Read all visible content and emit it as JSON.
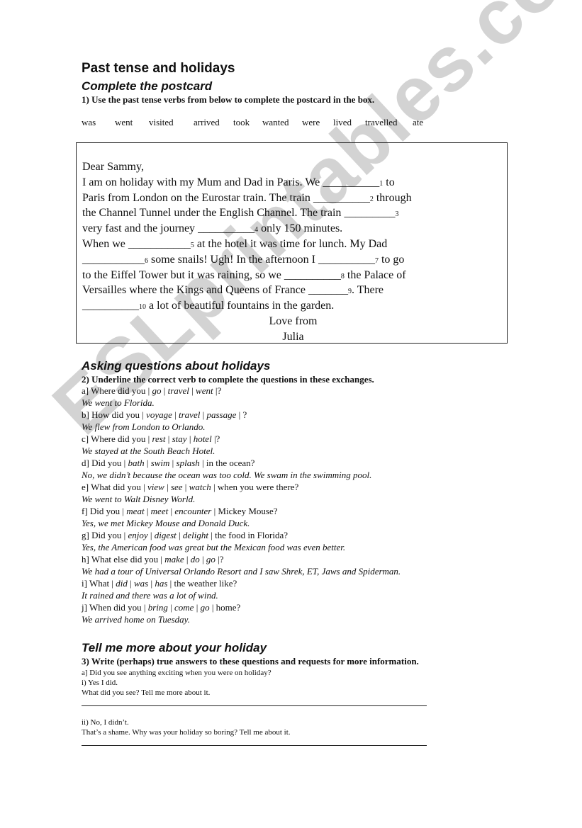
{
  "title": "Past tense and holidays",
  "section1": {
    "heading": "Complete the postcard",
    "instruction": "1) Use the past tense verbs from below to complete the postcard in the box.",
    "word_bank": [
      "was",
      "went",
      "visited",
      "arrived",
      "took",
      "wanted",
      "were",
      "lived",
      "travelled",
      "ate"
    ],
    "postcard": {
      "greeting": "Dear Sammy,",
      "lines": [
        {
          "pre": "I am on holiday with my Mum and Dad in Paris. We ",
          "blank": "__________",
          "num": "1",
          "post": " to"
        },
        {
          "pre": "Paris from London on the Eurostar train. The train ",
          "blank": "__________",
          "num": "2",
          "post": " through"
        },
        {
          "pre": "the Channel Tunnel under the English Channel. The train ",
          "blank": "_________",
          "num": "3",
          "post": ""
        },
        {
          "pre": "very fast and the journey ",
          "blank": "__________",
          "num": "4",
          "post": " only 150 minutes."
        },
        {
          "pre": "When we ",
          "blank": "___________",
          "num": "5",
          "post": " at the hotel it was time for lunch. My Dad"
        },
        {
          "pre": "",
          "blank": "___________",
          "num": "6",
          "post": " some snails! Ugh! In the afternoon I "
        },
        {
          "pre": "to the Eiffel Tower but it was raining, so we ",
          "blank": "__________",
          "num": "8",
          "post": " the Palace of"
        },
        {
          "pre": "Versailles where the Kings and Queens of France ",
          "blank": "_______",
          "num": "9",
          "post": ". There"
        },
        {
          "pre": "",
          "blank": "__________",
          "num": "10",
          "post": " a lot of beautiful fountains in the garden."
        }
      ],
      "line6_extra": {
        "blank": "__________",
        "num": "7",
        "post": " to go"
      },
      "closing": "Love from",
      "signature": "Julia"
    }
  },
  "section2": {
    "heading": "Asking questions about holidays",
    "instruction": "2) Underline the correct verb to complete the questions in these exchanges.",
    "items": [
      {
        "label": "a]",
        "pre": "Where did you |",
        "options": [
          "go",
          "travel",
          "went"
        ],
        "post": "|?",
        "answer": "We went to Florida."
      },
      {
        "label": "b]",
        "pre": "How did you |",
        "options": [
          "voyage",
          "travel",
          "passage"
        ],
        "post": "| ?",
        "answer": "We flew from London to Orlando."
      },
      {
        "label": "c]",
        "pre": "Where did you |",
        "options": [
          "rest",
          "stay",
          "hotel"
        ],
        "post": "|?",
        "answer": "We stayed at the South Beach Hotel."
      },
      {
        "label": "d]",
        "pre": "Did you |",
        "options": [
          "bath",
          "swim",
          "splash"
        ],
        "post": "| in the ocean?",
        "answer": "No, we didn’t because the ocean was too cold. We swam in the swimming pool."
      },
      {
        "label": "e]",
        "pre": "What did you |",
        "options": [
          "view",
          "see",
          "watch"
        ],
        "post": "| when you were there?",
        "answer": "We went to Walt Disney World."
      },
      {
        "label": "f]",
        "pre": "Did you |",
        "options": [
          "meat",
          "meet",
          "encounter"
        ],
        "post": "| Mickey Mouse?",
        "answer": "Yes, we met Mickey Mouse and Donald Duck."
      },
      {
        "label": "g]",
        "pre": "Did you |",
        "options": [
          "enjoy",
          "digest",
          "delight"
        ],
        "post": "| the food in Florida?",
        "answer": "Yes, the American food was great but the Mexican food was even better."
      },
      {
        "label": "h]",
        "pre": "What else did you |",
        "options": [
          "make",
          "do",
          "go"
        ],
        "post": "|?",
        "answer": "We had a tour of Universal Orlando Resort and I saw Shrek, ET, Jaws and Spiderman."
      },
      {
        "label": "i]",
        "pre": "What |",
        "options": [
          "did",
          "was",
          "has"
        ],
        "post": "| the weather like?",
        "answer": "It rained and there was a lot of wind."
      },
      {
        "label": "j]",
        "pre": "When did you |",
        "options": [
          "bring",
          "come",
          "go"
        ],
        "post": "| home?",
        "answer": "We arrived home on Tuesday."
      }
    ]
  },
  "section3": {
    "heading": "Tell me more about your holiday",
    "instruction": "3) Write (perhaps) true answers to these questions and requests for more information.",
    "question": "a] Did you see anything exciting when you were on holiday?",
    "yes_answer": "i) Yes I did.",
    "yes_prompt": "What did you see? Tell me more about it.",
    "no_answer": "ii) No, I didn’t.",
    "no_prompt": "That’s a shame. Why was your holiday so boring? Tell me about it."
  },
  "watermark": "ESLprintables.com"
}
